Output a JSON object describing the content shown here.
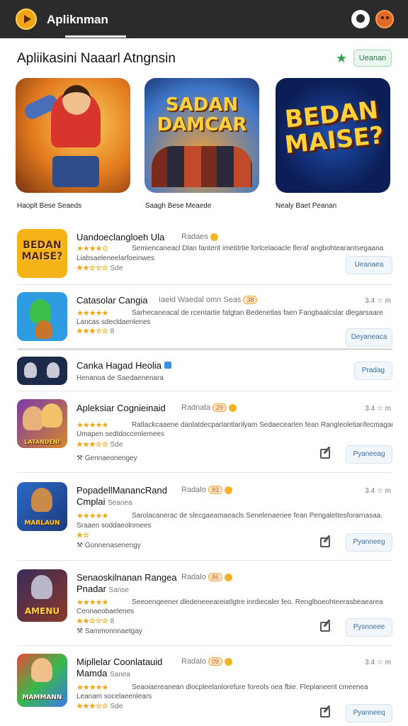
{
  "header": {
    "title": "Apliknman"
  },
  "section": {
    "title": "Apliikasini Naaarl Atngnsin",
    "button": "Ueanan"
  },
  "featured": [
    {
      "label": "Haoplt Bese Seaeds",
      "art": ""
    },
    {
      "label": "Saagh Bese Meaede",
      "art": "SADAN DAMCAR"
    },
    {
      "label": "Nealy Baet Peanan",
      "art": "BEDAN MAISE?"
    }
  ],
  "list": [
    {
      "thumb": "BEDAN MAISE?",
      "title": "Uandoeclangloeh Ula",
      "meta": "Radaes",
      "stars": "★★★★ 0",
      "desc": "Semiencaneacl Dlan fanterit imetitrtie forlcelaoacle fleraf angbohtearantsegaana",
      "sub": "Liabsaeleneelarfoeinwes",
      "small": "★★☆☆☆",
      "small_note": "Sde",
      "button": "Ueanaea"
    },
    {
      "thumb": "",
      "title": "Catasolar Cangia",
      "meta": "Iaeid Waedal omn Seas",
      "pill": "38",
      "rating": "3.4 ☆ m",
      "stars": "★★★★★",
      "desc": "Sarhecaneacal de rcentartie fatgtan Bedenetlas faen Fangbaalcslar dlegarsaare",
      "sub": "Lancas sdecldaenlenes",
      "small": "★★★☆☆",
      "small_note": "8",
      "button": "Deyaneaca"
    },
    {
      "thumb": "",
      "title": "Canka Hagad Heolia",
      "meta": "",
      "desc": "",
      "sub": "Henanoa de Saedaenenara",
      "button": "Pradag"
    },
    {
      "thumb": "LATANDENI",
      "title": "Apleksiar Cognieinaid",
      "meta": "Radnala",
      "pill": "29",
      "rating": "3.4 ☆ m",
      "stars": "★★★★★",
      "desc": "Ratlackcaaene danlatdecparlantlarilyam Sedaecearlen fean Rangleoletiarifecmaganaar.",
      "sub": "Umapen sedtdoccenlemees",
      "small": "★★★☆☆",
      "small_note": "Sde",
      "foot": "Gennaeonengey",
      "button": "Pyaneeag"
    },
    {
      "thumb": "MARLAUN",
      "title": "PopadellManancRand",
      "title2": "Cmplai",
      "meta": "Radalo",
      "pill": "83",
      "rating": "3.4 ☆ m",
      "title2_note": "Seanea",
      "stars": "★★★★★",
      "desc": "Sarolacanerac de slecgaeamaeacls Senelenaeriee fean Pengalettesforarnasaa.",
      "sub": "Sraaen soddaeolnmees",
      "small": "★☆",
      "small_note": "",
      "foot": "Gonnenasenengy",
      "button": "Pyanneeg"
    },
    {
      "thumb": "AMENU",
      "title": "Senaoskilnanan Rangea",
      "title2": "Pnadar",
      "meta": "Radalo",
      "pill": "86",
      "title2_note": "Sanse",
      "stars": "★★★★★",
      "desc": "Seeoenqeener dledeneeeareiatlgtre inrdiecaler feo. Renglboeohteerasbeaearea",
      "sub": "Cennaeobaelenes",
      "small": "★★☆☆☆",
      "small_note": "8",
      "foot": "Sammonnnaetgay",
      "button": "Pysnneee"
    },
    {
      "thumb": "MAMMANN",
      "title": "Mipllelar Coonlatauid",
      "title2": "Mamda",
      "meta": "Radalo",
      "pill": "09",
      "rating": "3.4 ☆ m",
      "title2_note": "Sanea",
      "stars": "★★★★★",
      "desc": "Seaoiaereanean dlocpleelanlorefure foreols oea fbie. Fleplaneent cmeenea",
      "sub": "Leanam socelaeenlears",
      "small": "★★★☆☆",
      "small_note": "Sde",
      "foot": "",
      "button": "Pyanneeq"
    }
  ]
}
